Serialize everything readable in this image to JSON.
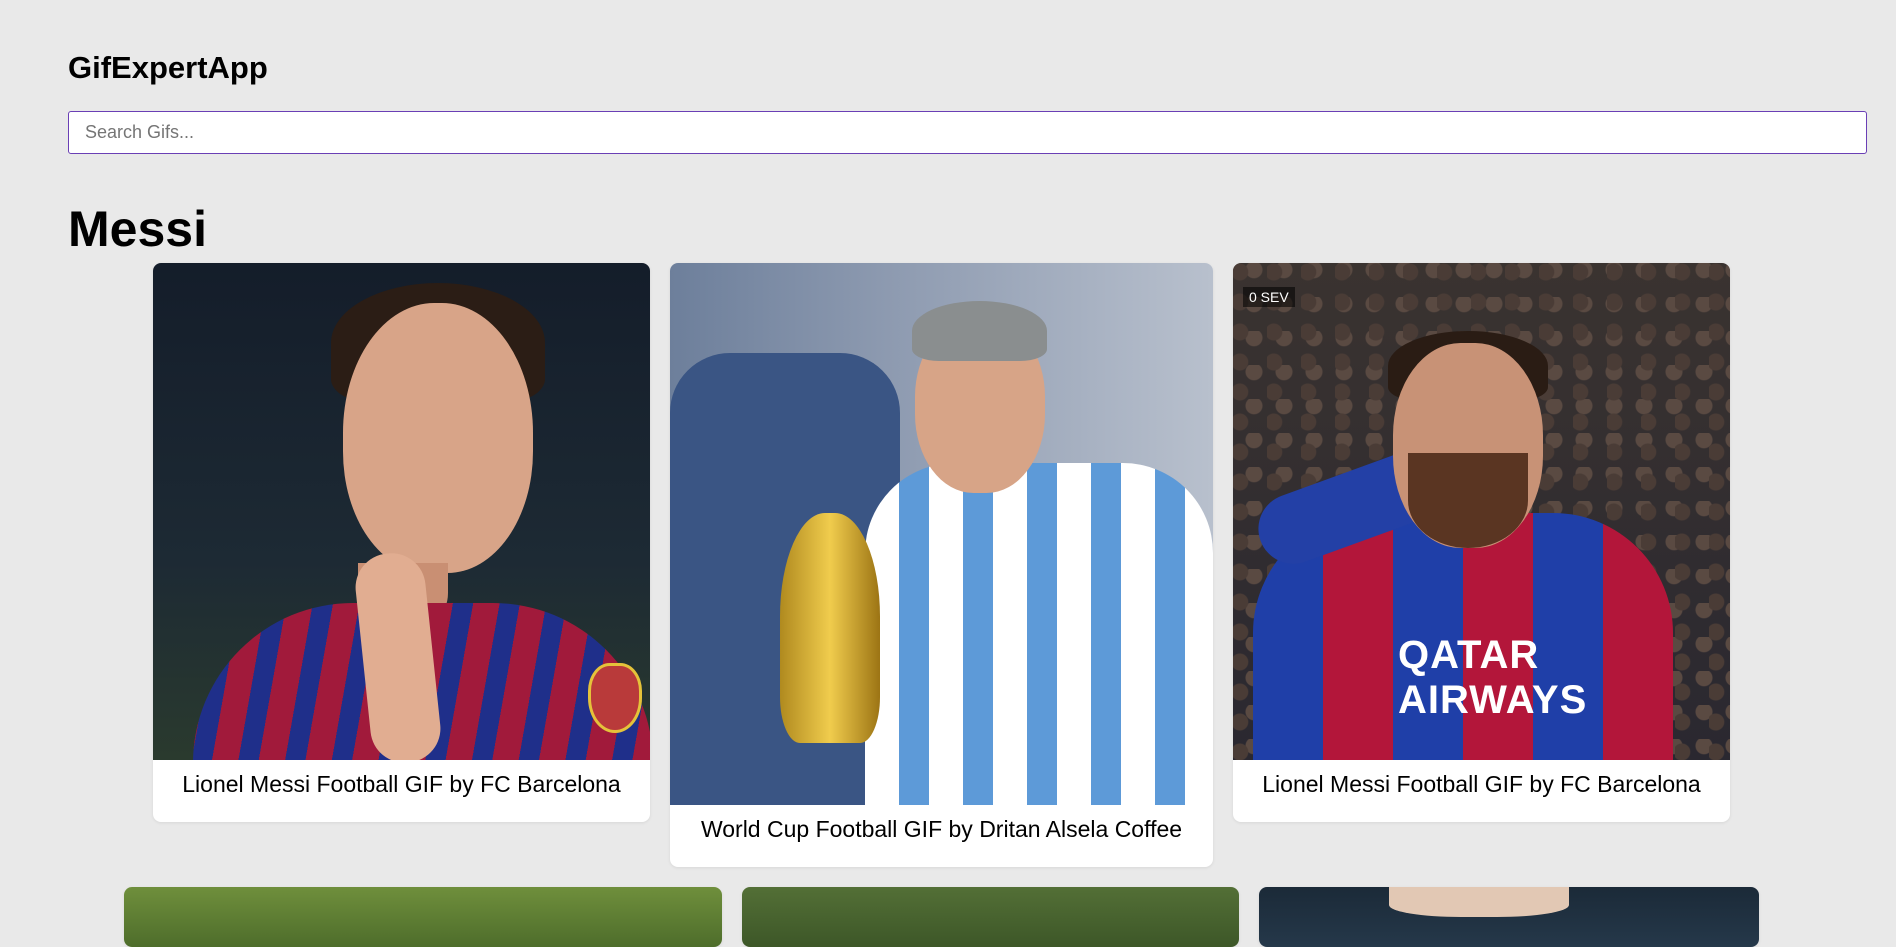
{
  "app": {
    "title": "GifExpertApp"
  },
  "search": {
    "placeholder": "Search Gifs...",
    "value": ""
  },
  "category": {
    "title": "Messi"
  },
  "gifs": [
    {
      "title": "Lionel Messi Football GIF by FC Barcelona"
    },
    {
      "title": "World Cup Football GIF by Dritan Alsela Coffee"
    },
    {
      "title": "Lionel Messi Football GIF by FC Barcelona",
      "overlay_text": "0 SEV",
      "sponsor_text": "QATAR AIRWAYS"
    }
  ],
  "colors": {
    "background": "#e9e9e9",
    "input_border": "#6a3fb5",
    "card": "#ffffff"
  }
}
